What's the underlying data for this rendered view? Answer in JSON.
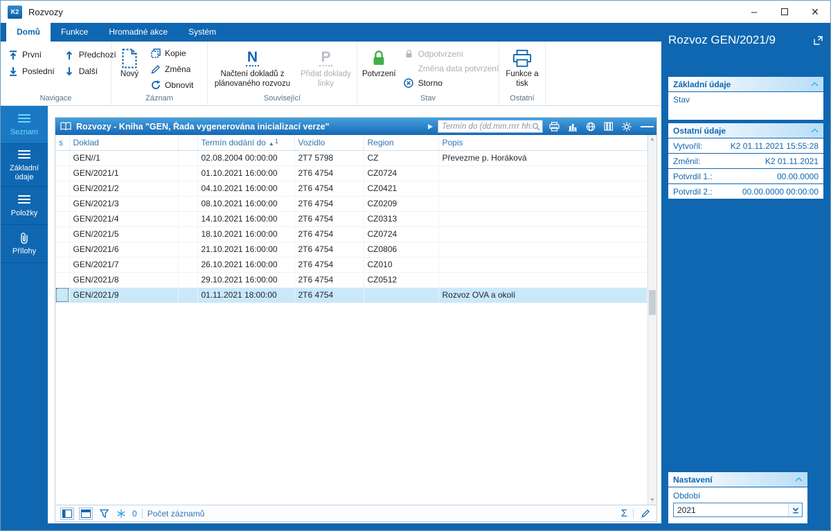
{
  "titlebar": {
    "app_logo": "K2",
    "title": "Rozvozy"
  },
  "icons": {
    "minimize": "–",
    "close": "×",
    "sigma": "Σ",
    "sort_asc": "▲",
    "scroll_up": "▲",
    "scroll_down": "▼"
  },
  "ribbon": {
    "tabs": [
      {
        "label": "Domů",
        "active": true
      },
      {
        "label": "Funkce",
        "active": false
      },
      {
        "label": "Hromadné akce",
        "active": false
      },
      {
        "label": "Systém",
        "active": false
      }
    ],
    "navigace": {
      "label": "Navigace",
      "prvni": "První",
      "posledni": "Poslední",
      "predchozi": "Předchozí",
      "dalsi": "Další"
    },
    "zaznam": {
      "label": "Záznam",
      "novy": "Nový",
      "kopie": "Kopie",
      "zmena": "Změna",
      "obnovit": "Obnovit"
    },
    "souvisejici": {
      "label": "Související",
      "nacteni": "Načtení dokladů z plánovaného rozvozu",
      "pridat": "Přidat doklady linky"
    },
    "stav": {
      "label": "Stav",
      "potvrzeni": "Potvrzení",
      "odpotvrzeni": "Odpotvrzení",
      "zmena_data": "Změna data potvrzení",
      "storno": "Storno"
    },
    "ostatni": {
      "label": "Ostatní",
      "funkce_tisk": "Funkce a tisk"
    }
  },
  "sidebar": {
    "items": [
      {
        "label": "Seznam",
        "icon": "list",
        "active": true
      },
      {
        "label": "Základní údaje",
        "icon": "form",
        "active": false
      },
      {
        "label": "Položky",
        "icon": "items",
        "active": false
      },
      {
        "label": "Přílohy",
        "icon": "paperclip",
        "active": false
      }
    ]
  },
  "table": {
    "title": "Rozvozy - Kniha \"GEN, Řada vygenerována inicializací verze\"",
    "search_placeholder": "Termín do (dd.mm.rrrr hh:...",
    "sort_number": "1",
    "columns": [
      {
        "key": "s",
        "label": "s",
        "sorted": false
      },
      {
        "key": "doklad",
        "label": "Doklad",
        "sorted": false
      },
      {
        "key": "spacer",
        "label": "",
        "sorted": false
      },
      {
        "key": "termin",
        "label": "Termín dodání do",
        "sorted": true
      },
      {
        "key": "vozidlo",
        "label": "Vozidlo",
        "sorted": false
      },
      {
        "key": "region",
        "label": "Region",
        "sorted": false
      },
      {
        "key": "popis",
        "label": "Popis",
        "sorted": false
      }
    ],
    "rows": [
      {
        "doklad": "GEN//1",
        "termin": "02.08.2004 00:00:00",
        "vozidlo": "2T7 5798",
        "region": "CZ",
        "popis": "Převezme p. Horáková",
        "selected": false
      },
      {
        "doklad": "GEN/2021/1",
        "termin": "01.10.2021 16:00:00",
        "vozidlo": "2T6 4754",
        "region": "CZ0724",
        "popis": "",
        "selected": false
      },
      {
        "doklad": "GEN/2021/2",
        "termin": "04.10.2021 16:00:00",
        "vozidlo": "2T6 4754",
        "region": "CZ0421",
        "popis": "",
        "selected": false
      },
      {
        "doklad": "GEN/2021/3",
        "termin": "08.10.2021 16:00:00",
        "vozidlo": "2T6 4754",
        "region": "CZ0209",
        "popis": "",
        "selected": false
      },
      {
        "doklad": "GEN/2021/4",
        "termin": "14.10.2021 16:00:00",
        "vozidlo": "2T6 4754",
        "region": "CZ0313",
        "popis": "",
        "selected": false
      },
      {
        "doklad": "GEN/2021/5",
        "termin": "18.10.2021 16:00:00",
        "vozidlo": "2T6 4754",
        "region": "CZ0724",
        "popis": "",
        "selected": false
      },
      {
        "doklad": "GEN/2021/6",
        "termin": "21.10.2021 16:00:00",
        "vozidlo": "2T6 4754",
        "region": "CZ0806",
        "popis": "",
        "selected": false
      },
      {
        "doklad": "GEN/2021/7",
        "termin": "26.10.2021 16:00:00",
        "vozidlo": "2T6 4754",
        "region": "CZ010",
        "popis": "",
        "selected": false
      },
      {
        "doklad": "GEN/2021/8",
        "termin": "29.10.2021 16:00:00",
        "vozidlo": "2T6 4754",
        "region": "CZ0512",
        "popis": "",
        "selected": false
      },
      {
        "doklad": "GEN/2021/9",
        "termin": "01.11.2021 18:00:00",
        "vozidlo": "2T6 4754",
        "region": "",
        "popis": "Rozvoz OVA a okolí",
        "selected": true
      }
    ],
    "footer": {
      "count": "0",
      "records_label": "Počet záznamů"
    }
  },
  "detail": {
    "title": "Rozvoz GEN/2021/9",
    "zakladni": {
      "header": "Základní údaje",
      "stav_label": "Stav"
    },
    "ostatni": {
      "header": "Ostatní údaje",
      "fields": [
        {
          "label": "Vytvořil:",
          "value": "K2 01.11.2021 15:55:28"
        },
        {
          "label": "Změnil:",
          "value": "K2 01.11.2021"
        },
        {
          "label": "Potvrdil 1.:",
          "value": "00.00.0000"
        },
        {
          "label": "Potvrdil 2.:",
          "value": "00.00.0000 00:00:00"
        }
      ]
    },
    "nastaveni": {
      "header": "Nastavení",
      "obdobi_label": "Období",
      "obdobi_value": "2021"
    }
  }
}
